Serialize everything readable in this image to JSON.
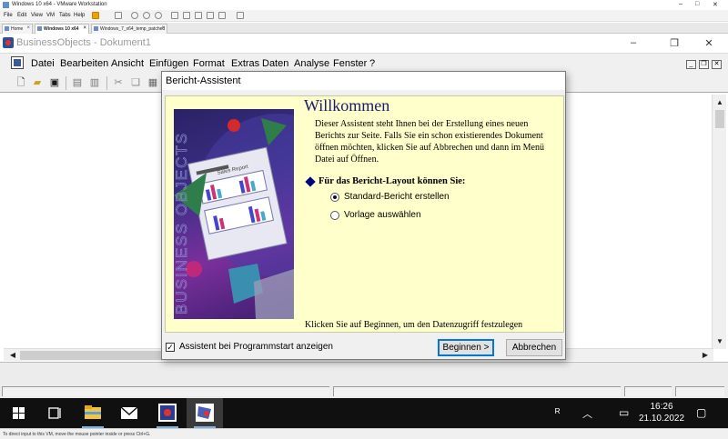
{
  "vmware": {
    "window_title": "Windows 10 x64 - VMware Workstation",
    "menu": [
      "File",
      "Edit",
      "View",
      "VM",
      "Tabs",
      "Help"
    ],
    "tabs": [
      {
        "label": "Home"
      },
      {
        "label": "Windows 10 x64"
      },
      {
        "label": "Windows_7_x64_temp_patched"
      }
    ],
    "status_text": "To direct input to this VM, move the mouse pointer inside or press Ctrl+G."
  },
  "app": {
    "title": "BusinessObjects - Dokument1",
    "menu": [
      "Datei",
      "Bearbeiten",
      "Ansicht",
      "Einfügen",
      "Format",
      "Extras",
      "Daten",
      "Analyse",
      "Fenster",
      "?"
    ]
  },
  "dialog": {
    "title": "Bericht-Assistent",
    "heading": "Willkommen",
    "intro": "Dieser Assistent steht Ihnen bei der Erstellung eines neuen Berichts zur Seite. Falls Sie ein schon existierendes Dokument öffnen möchten, klicken Sie auf Abbrechen und dann im Menü Datei auf Öffnen.",
    "layout_prompt": "Für das Bericht-Layout können Sie:",
    "options": [
      {
        "label": "Standard-Bericht erstellen",
        "selected": true
      },
      {
        "label": "Vorlage auswählen",
        "selected": false
      }
    ],
    "footer": "Klicken Sie auf Beginnen, um den Datenzugriff festzulegen",
    "image": {
      "brand_text": "BUSINESS OBJECTS",
      "report_title": "Sales Report"
    },
    "checkbox_label": "Assistent bei Programmstart anzeigen",
    "checkbox_checked": true,
    "buttons": {
      "start": "Beginnen >",
      "cancel": "Abbrechen"
    }
  },
  "taskbar": {
    "time": "16:26",
    "date": "21.10.2022"
  }
}
